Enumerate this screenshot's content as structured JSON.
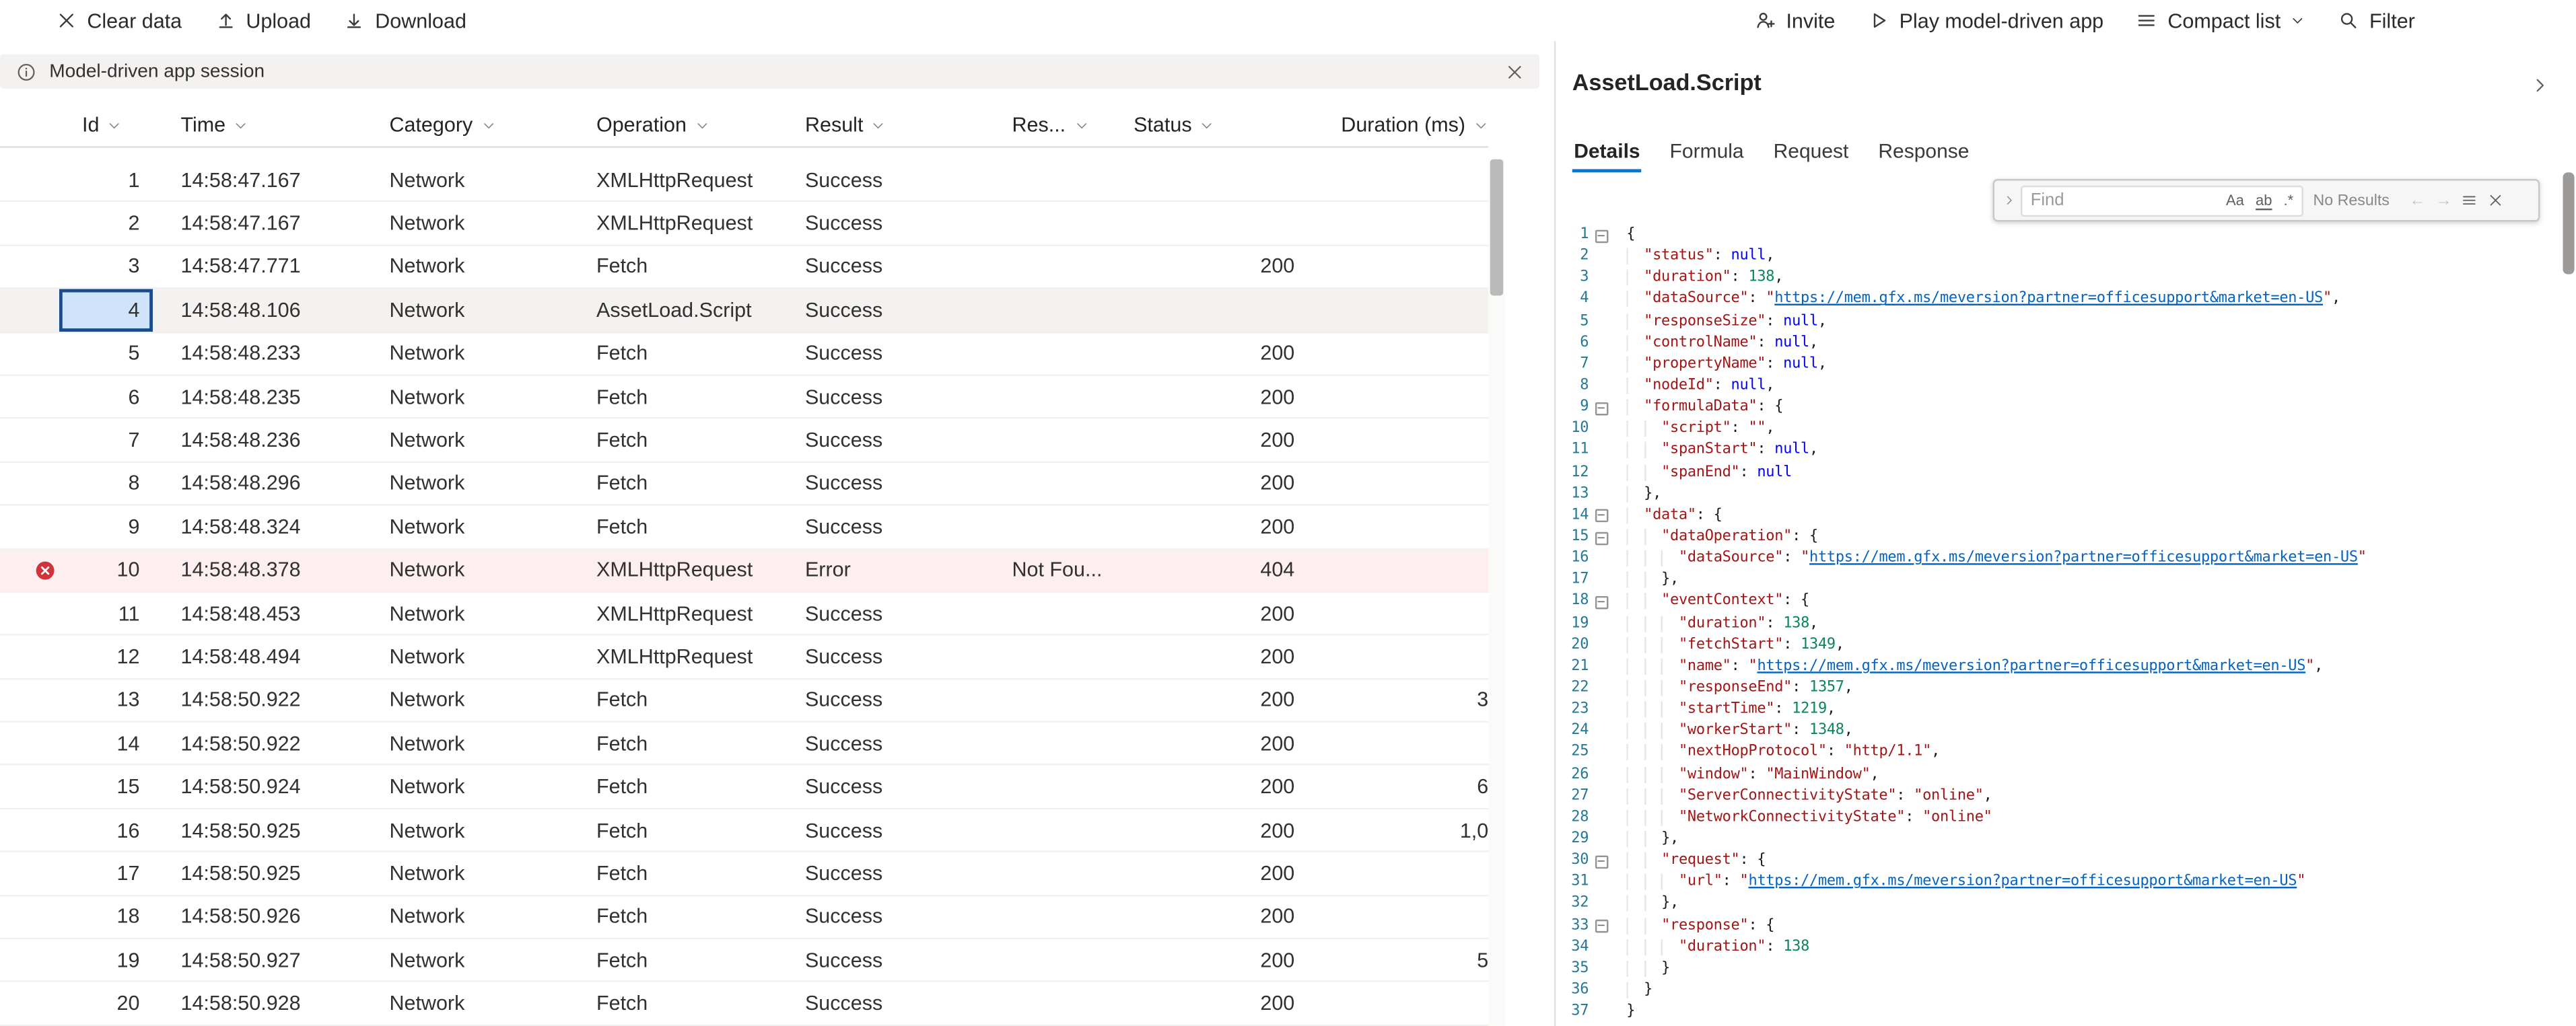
{
  "colors": {
    "accent": "#0078d4",
    "error_red": "#d13438",
    "selected_cell_fill": "#cfe4fa",
    "selected_cell_border": "#1b4c8a",
    "link_blue": "#0563c1",
    "line_number_teal": "#237893",
    "json_key_red": "#a31515",
    "json_number_green": "#098658",
    "json_null_blue": "#0000ff",
    "info_bar_bg": "#f3f2f1",
    "error_row_bg": "#fdeff1"
  },
  "toolbar": {
    "left": [
      {
        "name": "clear-data",
        "icon": "clear",
        "label": "Clear data"
      },
      {
        "name": "upload",
        "icon": "upload",
        "label": "Upload"
      },
      {
        "name": "download",
        "icon": "download",
        "label": "Download"
      }
    ],
    "right": [
      {
        "name": "invite",
        "icon": "person-add",
        "label": "Invite"
      },
      {
        "name": "play-model-driven-app",
        "icon": "play",
        "label": "Play model-driven app"
      },
      {
        "name": "compact-list",
        "icon": "list",
        "label": "Compact list",
        "chevron": true
      },
      {
        "name": "filter",
        "icon": "search",
        "label": "Filter"
      }
    ]
  },
  "info_bar": {
    "label": "Model-driven app session"
  },
  "grid": {
    "columns": [
      {
        "key": "id",
        "label": "Id"
      },
      {
        "key": "time",
        "label": "Time"
      },
      {
        "key": "category",
        "label": "Category"
      },
      {
        "key": "operation",
        "label": "Operation"
      },
      {
        "key": "result",
        "label": "Result"
      },
      {
        "key": "details",
        "label": "Res..."
      },
      {
        "key": "status",
        "label": "Status"
      },
      {
        "key": "duration",
        "label": "Duration (ms)"
      }
    ],
    "rows": [
      {
        "id": "1",
        "time": "14:58:47.167",
        "category": "Network",
        "operation": "XMLHttpRequest",
        "result": "Success",
        "details": "",
        "status": "",
        "duration": ""
      },
      {
        "id": "2",
        "time": "14:58:47.167",
        "category": "Network",
        "operation": "XMLHttpRequest",
        "result": "Success",
        "details": "",
        "status": "",
        "duration": ""
      },
      {
        "id": "3",
        "time": "14:58:47.771",
        "category": "Network",
        "operation": "Fetch",
        "result": "Success",
        "details": "",
        "status": "200",
        "duration": ""
      },
      {
        "id": "4",
        "time": "14:58:48.106",
        "category": "Network",
        "operation": "AssetLoad.Script",
        "result": "Success",
        "details": "",
        "status": "",
        "duration": "",
        "selected": true
      },
      {
        "id": "5",
        "time": "14:58:48.233",
        "category": "Network",
        "operation": "Fetch",
        "result": "Success",
        "details": "",
        "status": "200",
        "duration": ""
      },
      {
        "id": "6",
        "time": "14:58:48.235",
        "category": "Network",
        "operation": "Fetch",
        "result": "Success",
        "details": "",
        "status": "200",
        "duration": ""
      },
      {
        "id": "7",
        "time": "14:58:48.236",
        "category": "Network",
        "operation": "Fetch",
        "result": "Success",
        "details": "",
        "status": "200",
        "duration": ""
      },
      {
        "id": "8",
        "time": "14:58:48.296",
        "category": "Network",
        "operation": "Fetch",
        "result": "Success",
        "details": "",
        "status": "200",
        "duration": ""
      },
      {
        "id": "9",
        "time": "14:58:48.324",
        "category": "Network",
        "operation": "Fetch",
        "result": "Success",
        "details": "",
        "status": "200",
        "duration": ""
      },
      {
        "id": "10",
        "time": "14:58:48.378",
        "category": "Network",
        "operation": "XMLHttpRequest",
        "result": "Error",
        "details": "Not Fou...",
        "status": "404",
        "duration": "",
        "error": true
      },
      {
        "id": "11",
        "time": "14:58:48.453",
        "category": "Network",
        "operation": "XMLHttpRequest",
        "result": "Success",
        "details": "",
        "status": "200",
        "duration": ""
      },
      {
        "id": "12",
        "time": "14:58:48.494",
        "category": "Network",
        "operation": "XMLHttpRequest",
        "result": "Success",
        "details": "",
        "status": "200",
        "duration": ""
      },
      {
        "id": "13",
        "time": "14:58:50.922",
        "category": "Network",
        "operation": "Fetch",
        "result": "Success",
        "details": "",
        "status": "200",
        "duration": "3"
      },
      {
        "id": "14",
        "time": "14:58:50.922",
        "category": "Network",
        "operation": "Fetch",
        "result": "Success",
        "details": "",
        "status": "200",
        "duration": ""
      },
      {
        "id": "15",
        "time": "14:58:50.924",
        "category": "Network",
        "operation": "Fetch",
        "result": "Success",
        "details": "",
        "status": "200",
        "duration": "6"
      },
      {
        "id": "16",
        "time": "14:58:50.925",
        "category": "Network",
        "operation": "Fetch",
        "result": "Success",
        "details": "",
        "status": "200",
        "duration": "1,0"
      },
      {
        "id": "17",
        "time": "14:58:50.925",
        "category": "Network",
        "operation": "Fetch",
        "result": "Success",
        "details": "",
        "status": "200",
        "duration": ""
      },
      {
        "id": "18",
        "time": "14:58:50.926",
        "category": "Network",
        "operation": "Fetch",
        "result": "Success",
        "details": "",
        "status": "200",
        "duration": ""
      },
      {
        "id": "19",
        "time": "14:58:50.927",
        "category": "Network",
        "operation": "Fetch",
        "result": "Success",
        "details": "",
        "status": "200",
        "duration": "5"
      },
      {
        "id": "20",
        "time": "14:58:50.928",
        "category": "Network",
        "operation": "Fetch",
        "result": "Success",
        "details": "",
        "status": "200",
        "duration": ""
      }
    ]
  },
  "panel": {
    "title": "AssetLoad.Script",
    "tabs": [
      {
        "label": "Details",
        "active": true
      },
      {
        "label": "Formula"
      },
      {
        "label": "Request"
      },
      {
        "label": "Response"
      }
    ],
    "find": {
      "placeholder": "Find",
      "results_label": "No Results",
      "match_case": "Aa",
      "whole_word": "ab",
      "regex": ".*"
    }
  },
  "editor": {
    "lines": [
      {
        "n": 1,
        "fold": true,
        "t": [
          [
            "p",
            "{"
          ]
        ]
      },
      {
        "n": 2,
        "t": [
          [
            "w",
            "  "
          ],
          [
            "k",
            "\"status\""
          ],
          [
            "p",
            ": "
          ],
          [
            "u",
            "null"
          ],
          [
            "p",
            ","
          ]
        ]
      },
      {
        "n": 3,
        "t": [
          [
            "w",
            "  "
          ],
          [
            "k",
            "\"duration\""
          ],
          [
            "p",
            ": "
          ],
          [
            "n",
            "138"
          ],
          [
            "p",
            ","
          ]
        ]
      },
      {
        "n": 4,
        "t": [
          [
            "w",
            "  "
          ],
          [
            "k",
            "\"dataSource\""
          ],
          [
            "p",
            ": "
          ],
          [
            "s",
            "\""
          ],
          [
            "l",
            "https://mem.gfx.ms/meversion?partner=officesupport&market=en-US"
          ],
          [
            "s",
            "\""
          ],
          [
            "p",
            ","
          ]
        ]
      },
      {
        "n": 5,
        "t": [
          [
            "w",
            "  "
          ],
          [
            "k",
            "\"responseSize\""
          ],
          [
            "p",
            ": "
          ],
          [
            "u",
            "null"
          ],
          [
            "p",
            ","
          ]
        ]
      },
      {
        "n": 6,
        "t": [
          [
            "w",
            "  "
          ],
          [
            "k",
            "\"controlName\""
          ],
          [
            "p",
            ": "
          ],
          [
            "u",
            "null"
          ],
          [
            "p",
            ","
          ]
        ]
      },
      {
        "n": 7,
        "t": [
          [
            "w",
            "  "
          ],
          [
            "k",
            "\"propertyName\""
          ],
          [
            "p",
            ": "
          ],
          [
            "u",
            "null"
          ],
          [
            "p",
            ","
          ]
        ]
      },
      {
        "n": 8,
        "t": [
          [
            "w",
            "  "
          ],
          [
            "k",
            "\"nodeId\""
          ],
          [
            "p",
            ": "
          ],
          [
            "u",
            "null"
          ],
          [
            "p",
            ","
          ]
        ]
      },
      {
        "n": 9,
        "fold": true,
        "t": [
          [
            "w",
            "  "
          ],
          [
            "k",
            "\"formulaData\""
          ],
          [
            "p",
            ": {"
          ]
        ]
      },
      {
        "n": 10,
        "t": [
          [
            "w",
            "    "
          ],
          [
            "k",
            "\"script\""
          ],
          [
            "p",
            ": "
          ],
          [
            "s",
            "\"\""
          ],
          [
            "p",
            ","
          ]
        ]
      },
      {
        "n": 11,
        "t": [
          [
            "w",
            "    "
          ],
          [
            "k",
            "\"spanStart\""
          ],
          [
            "p",
            ": "
          ],
          [
            "u",
            "null"
          ],
          [
            "p",
            ","
          ]
        ]
      },
      {
        "n": 12,
        "t": [
          [
            "w",
            "    "
          ],
          [
            "k",
            "\"spanEnd\""
          ],
          [
            "p",
            ": "
          ],
          [
            "u",
            "null"
          ]
        ]
      },
      {
        "n": 13,
        "t": [
          [
            "w",
            "  "
          ],
          [
            "p",
            "},"
          ]
        ]
      },
      {
        "n": 14,
        "fold": true,
        "t": [
          [
            "w",
            "  "
          ],
          [
            "k",
            "\"data\""
          ],
          [
            "p",
            ": {"
          ]
        ]
      },
      {
        "n": 15,
        "fold": true,
        "t": [
          [
            "w",
            "    "
          ],
          [
            "k",
            "\"dataOperation\""
          ],
          [
            "p",
            ": {"
          ]
        ]
      },
      {
        "n": 16,
        "t": [
          [
            "w",
            "      "
          ],
          [
            "k",
            "\"dataSource\""
          ],
          [
            "p",
            ": "
          ],
          [
            "s",
            "\""
          ],
          [
            "l",
            "https://mem.gfx.ms/meversion?partner=officesupport&market=en-US"
          ],
          [
            "s",
            "\""
          ]
        ]
      },
      {
        "n": 17,
        "t": [
          [
            "w",
            "    "
          ],
          [
            "p",
            "},"
          ]
        ]
      },
      {
        "n": 18,
        "fold": true,
        "t": [
          [
            "w",
            "    "
          ],
          [
            "k",
            "\"eventContext\""
          ],
          [
            "p",
            ": {"
          ]
        ]
      },
      {
        "n": 19,
        "t": [
          [
            "w",
            "      "
          ],
          [
            "k",
            "\"duration\""
          ],
          [
            "p",
            ": "
          ],
          [
            "n",
            "138"
          ],
          [
            "p",
            ","
          ]
        ]
      },
      {
        "n": 20,
        "t": [
          [
            "w",
            "      "
          ],
          [
            "k",
            "\"fetchStart\""
          ],
          [
            "p",
            ": "
          ],
          [
            "n",
            "1349"
          ],
          [
            "p",
            ","
          ]
        ]
      },
      {
        "n": 21,
        "t": [
          [
            "w",
            "      "
          ],
          [
            "k",
            "\"name\""
          ],
          [
            "p",
            ": "
          ],
          [
            "s",
            "\""
          ],
          [
            "l",
            "https://mem.gfx.ms/meversion?partner=officesupport&market=en-US"
          ],
          [
            "s",
            "\""
          ],
          [
            "p",
            ","
          ]
        ]
      },
      {
        "n": 22,
        "t": [
          [
            "w",
            "      "
          ],
          [
            "k",
            "\"responseEnd\""
          ],
          [
            "p",
            ": "
          ],
          [
            "n",
            "1357"
          ],
          [
            "p",
            ","
          ]
        ]
      },
      {
        "n": 23,
        "t": [
          [
            "w",
            "      "
          ],
          [
            "k",
            "\"startTime\""
          ],
          [
            "p",
            ": "
          ],
          [
            "n",
            "1219"
          ],
          [
            "p",
            ","
          ]
        ]
      },
      {
        "n": 24,
        "t": [
          [
            "w",
            "      "
          ],
          [
            "k",
            "\"workerStart\""
          ],
          [
            "p",
            ": "
          ],
          [
            "n",
            "1348"
          ],
          [
            "p",
            ","
          ]
        ]
      },
      {
        "n": 25,
        "t": [
          [
            "w",
            "      "
          ],
          [
            "k",
            "\"nextHopProtocol\""
          ],
          [
            "p",
            ": "
          ],
          [
            "s",
            "\"http/1.1\""
          ],
          [
            "p",
            ","
          ]
        ]
      },
      {
        "n": 26,
        "t": [
          [
            "w",
            "      "
          ],
          [
            "k",
            "\"window\""
          ],
          [
            "p",
            ": "
          ],
          [
            "s",
            "\"MainWindow\""
          ],
          [
            "p",
            ","
          ]
        ]
      },
      {
        "n": 27,
        "t": [
          [
            "w",
            "      "
          ],
          [
            "k",
            "\"ServerConnectivityState\""
          ],
          [
            "p",
            ": "
          ],
          [
            "s",
            "\"online\""
          ],
          [
            "p",
            ","
          ]
        ]
      },
      {
        "n": 28,
        "t": [
          [
            "w",
            "      "
          ],
          [
            "k",
            "\"NetworkConnectivityState\""
          ],
          [
            "p",
            ": "
          ],
          [
            "s",
            "\"online\""
          ]
        ]
      },
      {
        "n": 29,
        "t": [
          [
            "w",
            "    "
          ],
          [
            "p",
            "},"
          ]
        ]
      },
      {
        "n": 30,
        "fold": true,
        "t": [
          [
            "w",
            "    "
          ],
          [
            "k",
            "\"request\""
          ],
          [
            "p",
            ": {"
          ]
        ]
      },
      {
        "n": 31,
        "t": [
          [
            "w",
            "      "
          ],
          [
            "k",
            "\"url\""
          ],
          [
            "p",
            ": "
          ],
          [
            "s",
            "\""
          ],
          [
            "l",
            "https://mem.gfx.ms/meversion?partner=officesupport&market=en-US"
          ],
          [
            "s",
            "\""
          ]
        ]
      },
      {
        "n": 32,
        "t": [
          [
            "w",
            "    "
          ],
          [
            "p",
            "},"
          ]
        ]
      },
      {
        "n": 33,
        "fold": true,
        "t": [
          [
            "w",
            "    "
          ],
          [
            "k",
            "\"response\""
          ],
          [
            "p",
            ": {"
          ]
        ]
      },
      {
        "n": 34,
        "t": [
          [
            "w",
            "      "
          ],
          [
            "k",
            "\"duration\""
          ],
          [
            "p",
            ": "
          ],
          [
            "n",
            "138"
          ]
        ]
      },
      {
        "n": 35,
        "t": [
          [
            "w",
            "    "
          ],
          [
            "p",
            "}"
          ]
        ]
      },
      {
        "n": 36,
        "t": [
          [
            "w",
            "  "
          ],
          [
            "p",
            "}"
          ]
        ]
      },
      {
        "n": 37,
        "t": [
          [
            "p",
            "}"
          ]
        ]
      }
    ]
  }
}
